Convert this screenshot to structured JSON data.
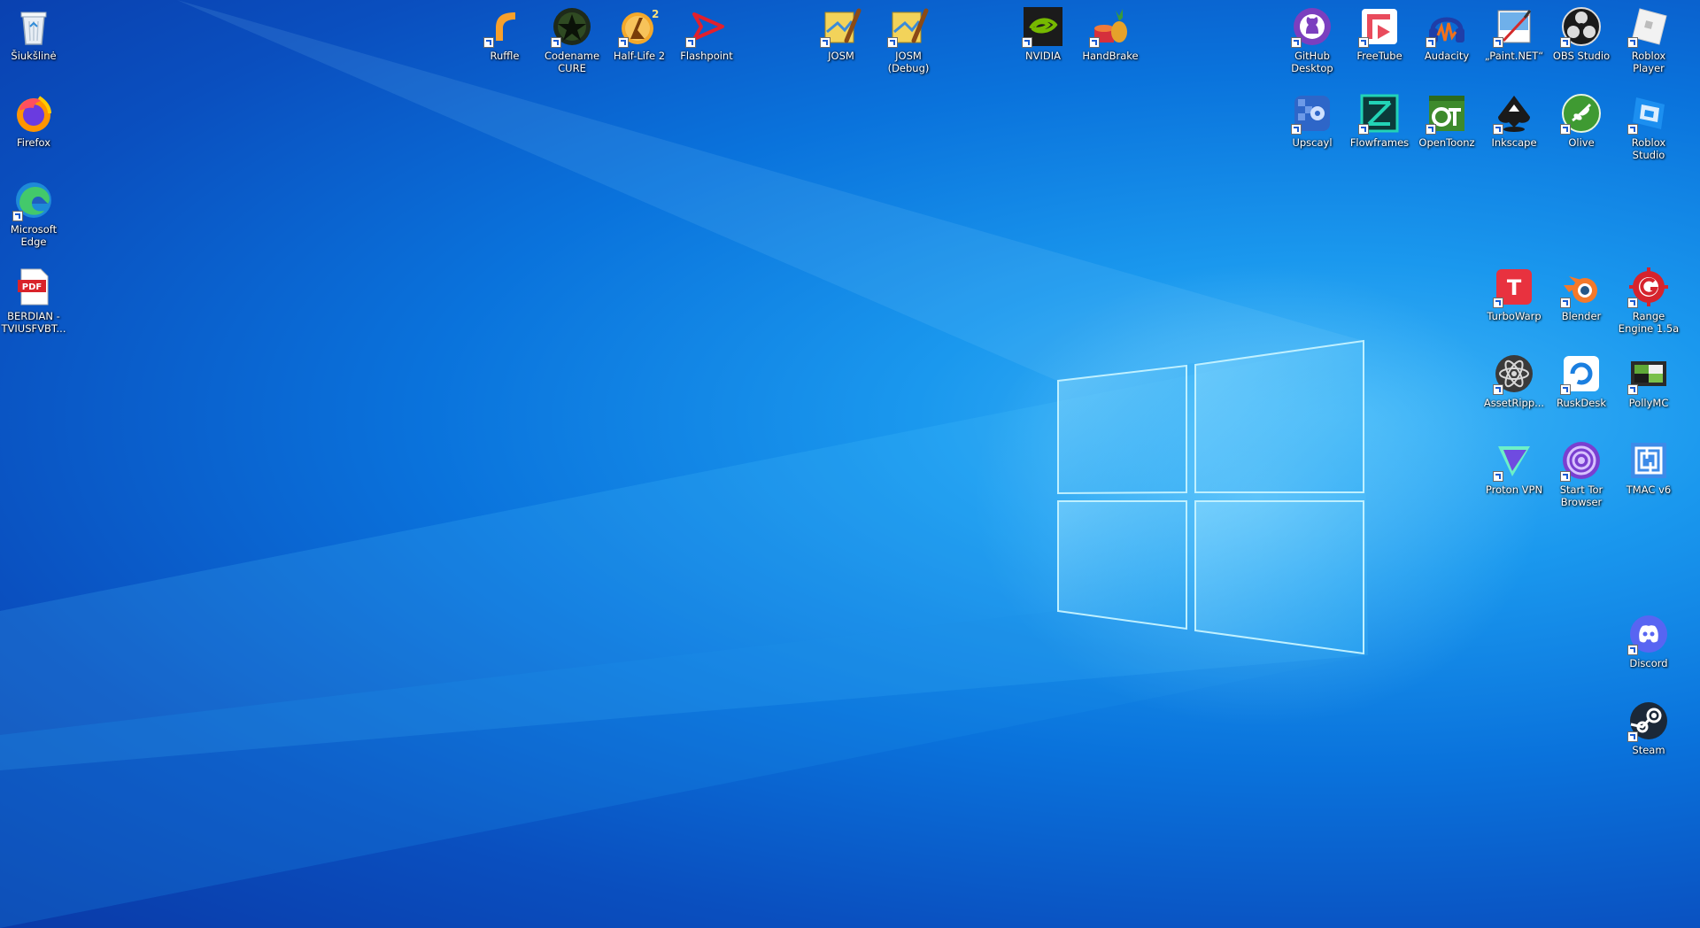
{
  "desktop": {
    "icons": [
      {
        "id": "recycle-bin",
        "label": "Šiukšlinė",
        "icon": "recycle-bin-icon",
        "shortcut": false
      },
      {
        "id": "firefox",
        "label": "Firefox",
        "icon": "firefox-icon",
        "shortcut": false
      },
      {
        "id": "microsoft-edge",
        "label": "Microsoft Edge",
        "icon": "edge-icon",
        "shortcut": true
      },
      {
        "id": "berdian-pdf",
        "label": "BERDIAN -TVIUSFVBT...",
        "icon": "pdf-file-icon",
        "shortcut": false
      },
      {
        "id": "ruffle",
        "label": "Ruffle",
        "icon": "ruffle-icon",
        "shortcut": true
      },
      {
        "id": "codename-cure",
        "label": "Codename CURE",
        "icon": "codename-cure-icon",
        "shortcut": true
      },
      {
        "id": "half-life-2",
        "label": "Half-Life 2",
        "icon": "half-life-2-icon",
        "shortcut": true
      },
      {
        "id": "flashpoint",
        "label": "Flashpoint",
        "icon": "flashpoint-icon",
        "shortcut": true
      },
      {
        "id": "josm",
        "label": "JOSM",
        "icon": "josm-icon",
        "shortcut": true
      },
      {
        "id": "josm-debug",
        "label": "JOSM (Debug)",
        "icon": "josm-debug-icon",
        "shortcut": true
      },
      {
        "id": "nvidia",
        "label": "NVIDIA",
        "icon": "nvidia-icon",
        "shortcut": true
      },
      {
        "id": "handbrake",
        "label": "HandBrake",
        "icon": "handbrake-icon",
        "shortcut": true
      },
      {
        "id": "github-desktop",
        "label": "GitHub Desktop",
        "icon": "github-icon",
        "shortcut": true
      },
      {
        "id": "freetube",
        "label": "FreeTube",
        "icon": "freetube-icon",
        "shortcut": true
      },
      {
        "id": "audacity",
        "label": "Audacity",
        "icon": "audacity-icon",
        "shortcut": true
      },
      {
        "id": "paint-net",
        "label": "„Paint.NET“",
        "icon": "paint-net-icon",
        "shortcut": true
      },
      {
        "id": "obs-studio",
        "label": "OBS Studio",
        "icon": "obs-icon",
        "shortcut": true
      },
      {
        "id": "roblox-player",
        "label": "Roblox Player",
        "icon": "roblox-icon",
        "shortcut": true
      },
      {
        "id": "upscayl",
        "label": "Upscayl",
        "icon": "upscayl-icon",
        "shortcut": true
      },
      {
        "id": "flowframes",
        "label": "Flowframes",
        "icon": "flowframes-icon",
        "shortcut": true
      },
      {
        "id": "opentoonz",
        "label": "OpenToonz",
        "icon": "opentoonz-icon",
        "shortcut": true
      },
      {
        "id": "inkscape",
        "label": "Inkscape",
        "icon": "inkscape-icon",
        "shortcut": true
      },
      {
        "id": "olive",
        "label": "Olive",
        "icon": "olive-icon",
        "shortcut": true
      },
      {
        "id": "roblox-studio",
        "label": "Roblox Studio",
        "icon": "roblox-studio-icon",
        "shortcut": true
      },
      {
        "id": "turbowarp",
        "label": "TurboWarp",
        "icon": "turbowarp-icon",
        "shortcut": true
      },
      {
        "id": "blender",
        "label": "Blender",
        "icon": "blender-icon",
        "shortcut": true
      },
      {
        "id": "range-engine",
        "label": "Range Engine 1.5a",
        "icon": "range-engine-icon",
        "shortcut": true
      },
      {
        "id": "assetripper",
        "label": "AssetRipp...",
        "icon": "assetripper-icon",
        "shortcut": true
      },
      {
        "id": "rustdesk",
        "label": "RuskDesk",
        "icon": "rustdesk-icon",
        "shortcut": true
      },
      {
        "id": "pollymc",
        "label": "PollyMC",
        "icon": "pollymc-icon",
        "shortcut": true
      },
      {
        "id": "proton-vpn",
        "label": "Proton VPN",
        "icon": "proton-vpn-icon",
        "shortcut": true
      },
      {
        "id": "tor-browser",
        "label": "Start Tor Browser",
        "icon": "tor-browser-icon",
        "shortcut": true
      },
      {
        "id": "tmac",
        "label": "TMAC v6",
        "icon": "tmac-icon",
        "shortcut": false
      },
      {
        "id": "discord",
        "label": "Discord",
        "icon": "discord-icon",
        "shortcut": true
      },
      {
        "id": "steam",
        "label": "Steam",
        "icon": "steam-icon",
        "shortcut": true
      }
    ]
  }
}
